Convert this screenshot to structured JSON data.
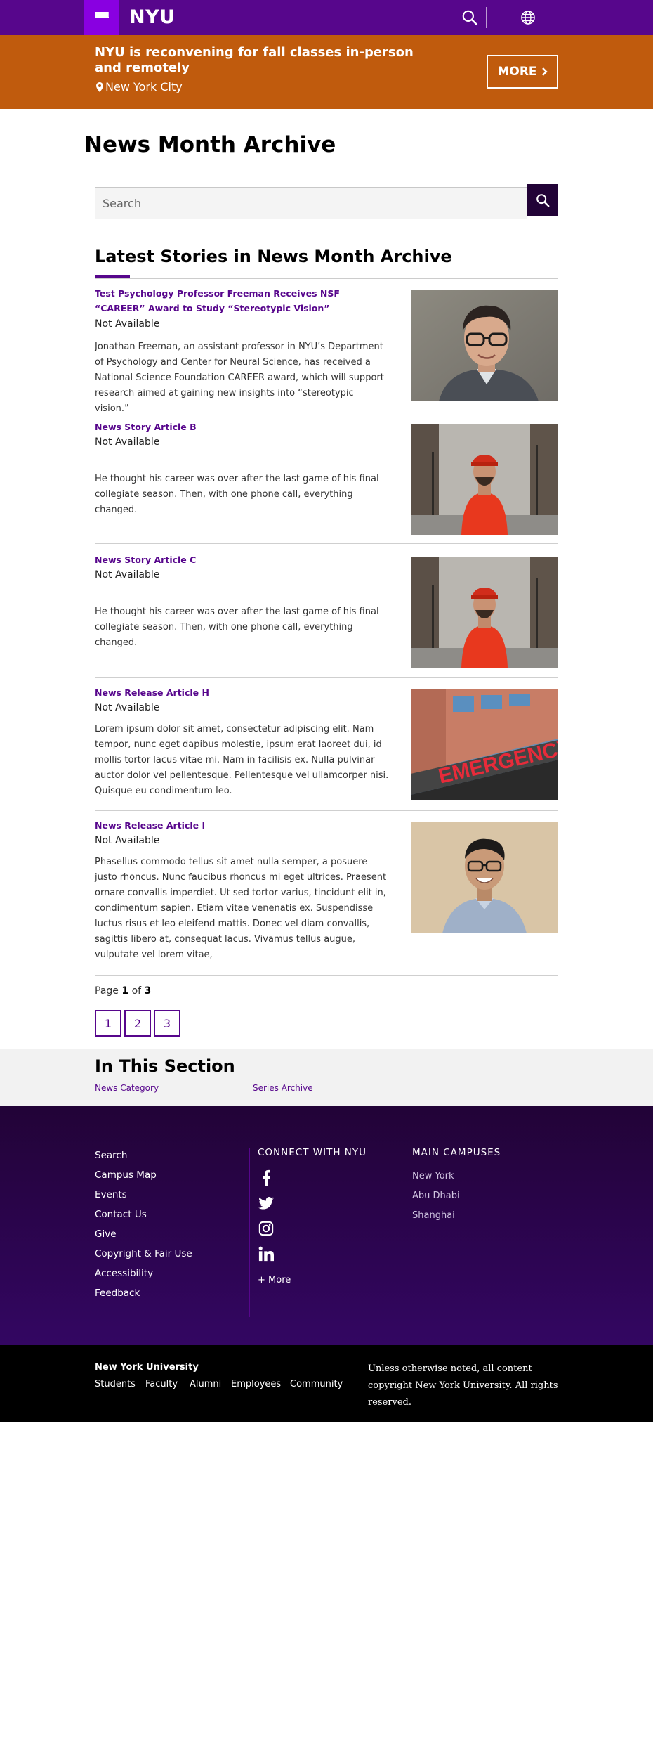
{
  "header": {
    "logo": "NYU",
    "menu_icon": "hamburger-menu-icon",
    "search_icon": "search-icon",
    "globe_icon": "globe-icon",
    "brand_color": "#57068c"
  },
  "alert": {
    "title": "NYU is reconvening for fall classes in-person and remotely",
    "location": "New York City",
    "location_icon": "map-pin-icon",
    "more_label": "MORE",
    "color": "#c05b0d"
  },
  "page_title": "News Month Archive",
  "search": {
    "placeholder": "Search",
    "button_icon": "search-icon"
  },
  "latest": {
    "heading": "Latest Stories in News Month Archive",
    "stories": [
      {
        "title": "Test Psychology Professor Freeman Receives NSF “CAREER” Award to Study “Stereotypic Vision”",
        "date": "Not Available",
        "description": "Jonathan Freeman, an assistant professor in NYU’s Department of Psychology and Center for Neural Science, has received a National Science Foundation CAREER award, which will support research aimed at gaining new insights into “stereotypic vision.”",
        "image": "portrait-man-glasses"
      },
      {
        "title": "News Story Article B",
        "date": "Not Available",
        "description": "He thought his career was over after the last game of his final collegiate season. Then, with one phone call, everything changed.",
        "image": "man-red-shirt-park"
      },
      {
        "title": "News Story Article C",
        "date": "Not Available",
        "description": "He thought his career was over after the last game of his final collegiate season. Then, with one phone call, everything changed.",
        "image": "man-red-shirt-park"
      },
      {
        "title": "News Release Article H",
        "date": "Not Available",
        "description": "Lorem ipsum dolor sit amet, consectetur adipiscing elit. Nam tempor, nunc eget dapibus molestie, ipsum erat laoreet dui, id mollis tortor lacus vitae mi. Nam in facilisis ex. Nulla pulvinar auctor dolor vel pellentesque. Pellentesque vel ullamcorper nisi. Quisque eu condimentum leo.",
        "image": "emergency-building",
        "image_text": "EMERGENCY"
      },
      {
        "title": "News Release Article I",
        "date": "Not Available",
        "description": "Phasellus commodo tellus sit amet nulla semper, a posuere justo rhoncus. Nunc faucibus rhoncus mi eget ultrices. Praesent ornare convallis imperdiet. Ut sed tortor varius, tincidunt elit in, condimentum sapien. Etiam vitae venenatis ex. Suspendisse luctus risus et leo eleifend mattis. Donec vel diam convallis, sagittis libero at, consequat lacus. Vivamus tellus augue, vulputate vel lorem vitae,",
        "image": "portrait-man-blue-shirt"
      }
    ]
  },
  "pagination": {
    "prefix": "Page",
    "current": "1",
    "of": "of",
    "total": "3",
    "pages": [
      "1",
      "2",
      "3"
    ]
  },
  "in_section": {
    "heading": "In This Section",
    "links": [
      "News Category",
      "Series Archive"
    ]
  },
  "footer": {
    "links": [
      "Search",
      "Campus Map",
      "Events",
      "Contact Us",
      "Give",
      "Copyright & Fair Use",
      "Accessibility",
      "Feedback"
    ],
    "connect_heading": "CONNECT WITH NYU",
    "social_icons": [
      "facebook-icon",
      "twitter-icon",
      "instagram-icon",
      "linkedin-icon"
    ],
    "more_label": "+ More",
    "campuses_heading": "MAIN CAMPUSES",
    "campuses": [
      "New York",
      "Abu Dhabi",
      "Shanghai"
    ]
  },
  "bottom": {
    "name": "New York University",
    "links": [
      "Students",
      "Faculty",
      "Alumni",
      "Employees",
      "Community"
    ],
    "copyright": "Unless otherwise noted, all content copyright New York University. All rights reserved."
  }
}
